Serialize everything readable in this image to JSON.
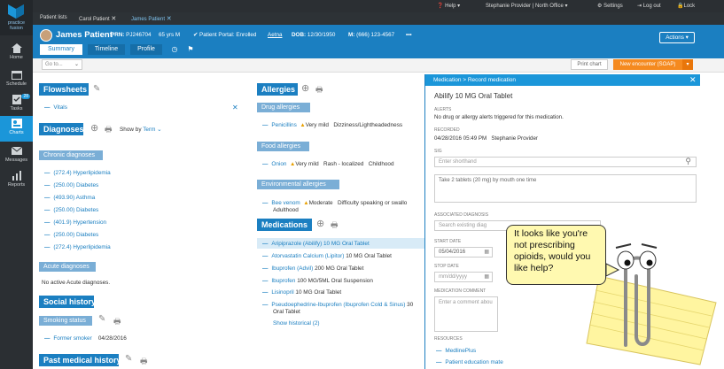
{
  "brand": {
    "logo_line1": "practice",
    "logo_line2": "fusion"
  },
  "sidebar": {
    "items": [
      {
        "label": "Home",
        "icon": "home-icon"
      },
      {
        "label": "Schedule",
        "icon": "calendar-icon"
      },
      {
        "label": "Tasks",
        "icon": "tasks-icon",
        "badge": "28"
      },
      {
        "label": "Charts",
        "icon": "charts-icon",
        "active": true
      },
      {
        "label": "Messages",
        "icon": "envelope-icon"
      },
      {
        "label": "Reports",
        "icon": "reports-icon"
      }
    ]
  },
  "topbar": {
    "help": "Help",
    "user": "Stephanie Provider",
    "office": "North Office",
    "settings": "Settings",
    "logout": "Log out",
    "lock": "Lock"
  },
  "tabs": {
    "patient_lists": "Patient lists",
    "tab1": "Carol Patient",
    "tab2": "James Patient"
  },
  "patient": {
    "name": "James Patient",
    "prn_label": "PRN:",
    "prn": "PJ246704",
    "age_sex": "65 yrs M",
    "portal": "Patient Portal: Enrolled",
    "insurance": "Aetna",
    "dob_label": "DOB:",
    "dob": "12/30/1950",
    "m_label": "M:",
    "phone": "(666) 123-4567",
    "more": "•••",
    "actions": "Actions"
  },
  "subtabs": [
    "Summary",
    "Timeline",
    "Profile"
  ],
  "toolbar": {
    "goto": "Go to...",
    "print": "Print chart",
    "new_encounter": "New encounter (SOAP)"
  },
  "left": {
    "flowsheets": "Flowsheets",
    "vitals": "Vitals",
    "diagnoses": "Diagnoses",
    "show_by": "Show by",
    "term": "Term",
    "chronic": "Chronic diagnoses",
    "chronic_items": [
      "(272.4) Hyperlipidemia",
      "(250.00) Diabetes",
      "(493.90) Asthma",
      "(250.00) Diabetes",
      "(401.9) Hypertension",
      "(250.00) Diabetes",
      "(272.4) Hyperlipidemia"
    ],
    "acute": "Acute diagnoses",
    "acute_none": "No active Acute diagnoses.",
    "social": "Social history",
    "smoking": "Smoking status",
    "smoker": "Former smoker",
    "smoker_date": "04/28/2016",
    "pmh": "Past medical history"
  },
  "middle": {
    "allergies": "Allergies",
    "drug_allergies": "Drug allergies",
    "drug": {
      "name": "Penicillins",
      "severity": "Very mild",
      "reaction": "Dizziness/Lightheadedness"
    },
    "food_allergies": "Food allergies",
    "food": {
      "name": "Onion",
      "severity": "Very mild",
      "reaction": "Rash - localized",
      "onset": "Childhood"
    },
    "env_allergies": "Environmental allergies",
    "env": {
      "name": "Bee venom",
      "severity": "Moderate",
      "reaction": "Difficulty speaking or swallo",
      "onset": "Adulthood"
    },
    "medications": "Medications",
    "med_items": [
      {
        "name": "Aripiprazole (Abilify)",
        "dose": "10 MG Oral Tablet"
      },
      {
        "name": "Atorvastatin Calcium (Lipitor)",
        "dose": "10 MG Oral Tablet"
      },
      {
        "name": "Ibuprofen (Advil)",
        "dose": "200 MG Oral Tablet"
      },
      {
        "name": "Ibuprofen",
        "dose": "100 MG/5ML Oral Suspension"
      },
      {
        "name": "Lisinopril",
        "dose": "10 MG Oral Tablet"
      },
      {
        "name": "Pseudoephedrine-Ibuprofen (Ibuprofen Cold & Sinus)",
        "dose": "30",
        "dose2": "Oral Tablet"
      }
    ],
    "show_historical": "Show historical (2)"
  },
  "panel": {
    "breadcrumb": "Medication > Record medication",
    "med_title": "Abilify 10 MG Oral Tablet",
    "alerts_label": "ALERTS",
    "alerts_text": "No drug or allergy alerts triggered for this medication.",
    "recorded_label": "RECORDED",
    "recorded_date": "04/28/2016 05:49 PM",
    "recorded_by": "Stephanie Provider",
    "sig_label": "SIG",
    "sig_placeholder": "Enter shorthand",
    "sig_text": "Take 2 tablets (20 mg) by mouth one time",
    "assoc_label": "ASSOCIATED DIAGNOSIS",
    "assoc_placeholder": "Search existing diag",
    "start_label": "START DATE",
    "start_value": "05/04/2016",
    "stop_label": "STOP DATE",
    "stop_placeholder": "mm/dd/yyyy",
    "comment_label": "MEDICATION COMMENT",
    "comment_placeholder": "Enter a comment abou",
    "resources_label": "RESOURCES",
    "res1": "MedlinePlus",
    "res2": "Patient education mate"
  },
  "clippy": {
    "message": "It looks like you're not prescribing opioids, would you like help?"
  }
}
